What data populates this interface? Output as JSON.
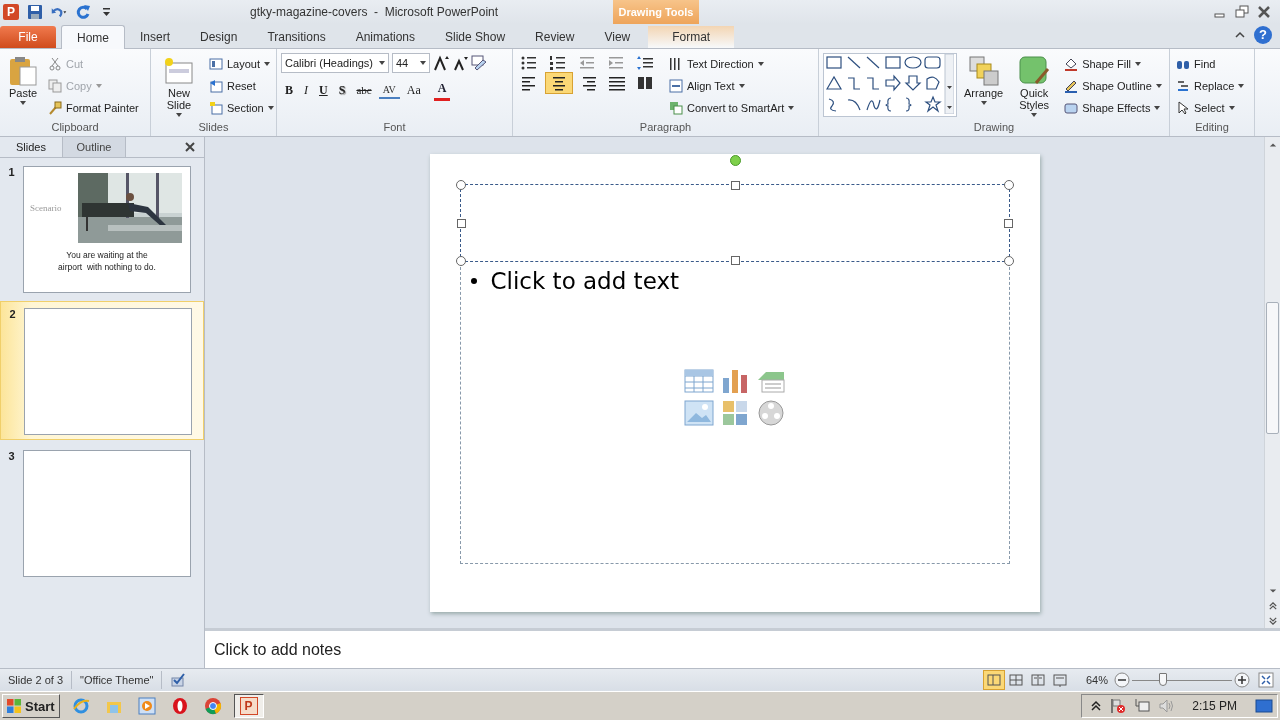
{
  "title_bar": {
    "app_logo": "P",
    "title": "gtky-magazine-covers  -  Microsoft PowerPoint",
    "help": "?"
  },
  "contextual_group": "Drawing Tools",
  "tabs": [
    {
      "label": "File",
      "kind": "file",
      "selected": false
    },
    {
      "label": "Home",
      "kind": "normal",
      "selected": true
    },
    {
      "label": "Insert",
      "kind": "normal",
      "selected": false
    },
    {
      "label": "Design",
      "kind": "normal",
      "selected": false
    },
    {
      "label": "Transitions",
      "kind": "normal",
      "selected": false
    },
    {
      "label": "Animations",
      "kind": "normal",
      "selected": false
    },
    {
      "label": "Slide Show",
      "kind": "normal",
      "selected": false
    },
    {
      "label": "Review",
      "kind": "normal",
      "selected": false
    },
    {
      "label": "View",
      "kind": "normal",
      "selected": false
    },
    {
      "label": "Format",
      "kind": "contextual",
      "selected": false
    }
  ],
  "ribbon": {
    "clipboard": {
      "label": "Clipboard",
      "paste": "Paste",
      "cut": {
        "label": "Cut",
        "disabled": true
      },
      "copy": {
        "label": "Copy",
        "disabled": true
      },
      "format_painter": "Format Painter"
    },
    "slides": {
      "label": "Slides",
      "new_slide": "New Slide",
      "layout": "Layout",
      "reset": "Reset",
      "section": "Section"
    },
    "font": {
      "label": "Font",
      "font_name": "Calibri (Headings)",
      "font_size": "44",
      "buttons": [
        {
          "label": "B",
          "kind": "bold"
        },
        {
          "label": "I",
          "kind": "italic"
        },
        {
          "label": "U",
          "kind": "underline"
        },
        {
          "label": "S",
          "kind": "shadow"
        },
        {
          "label": "abc",
          "kind": "strike"
        },
        {
          "label": "AV",
          "kind": "spacing"
        },
        {
          "label": "Aa",
          "kind": "case"
        },
        {
          "label": "A",
          "kind": "color"
        }
      ]
    },
    "paragraph": {
      "label": "Paragraph",
      "alignments": [
        {
          "selected": false
        },
        {
          "selected": true
        },
        {
          "selected": false
        },
        {
          "selected": false
        }
      ],
      "text_direction": "Text Direction",
      "align_text": "Align Text",
      "convert": "Convert to SmartArt"
    },
    "drawing": {
      "label": "Drawing",
      "arrange": "Arrange",
      "quick_styles": "Quick Styles",
      "shape_fill": "Shape Fill",
      "shape_outline": "Shape Outline",
      "shape_effects": "Shape Effects"
    },
    "editing": {
      "label": "Editing",
      "find": "Find",
      "replace": "Replace",
      "select": "Select"
    }
  },
  "panel": {
    "tabs": [
      {
        "label": "Slides",
        "selected": true
      },
      {
        "label": "Outline",
        "selected": false
      }
    ],
    "thumbnails": [
      {
        "number": "1",
        "selected": false,
        "kind": "picture",
        "title": "Scenario",
        "caption_lines": [
          "You are waiting at the",
          "airport  with nothing to do."
        ]
      },
      {
        "number": "2",
        "selected": true,
        "kind": "blank"
      },
      {
        "number": "3",
        "selected": false,
        "kind": "blank"
      }
    ]
  },
  "slide": {
    "content_placeholder": "Click to add text",
    "title_selected": true
  },
  "notes": {
    "placeholder": "Click to add notes"
  },
  "status_bar": {
    "slide": "Slide 2 of 3",
    "theme": "\"Office Theme\"",
    "views": [
      {
        "selected": true
      },
      {
        "selected": false
      },
      {
        "selected": false
      },
      {
        "selected": false
      }
    ],
    "zoom": "64%",
    "zoom_slider": {
      "level": 0.31
    }
  },
  "taskbar": {
    "start": "Start",
    "apps": [
      {
        "kind": "ie",
        "selected": false
      },
      {
        "kind": "folder",
        "selected": false
      },
      {
        "kind": "media",
        "selected": false
      },
      {
        "kind": "opera",
        "selected": false
      },
      {
        "kind": "chrome",
        "selected": false
      },
      {
        "kind": "powerpoint",
        "label": "P",
        "selected": true
      }
    ],
    "clock": "2:15 PM"
  }
}
